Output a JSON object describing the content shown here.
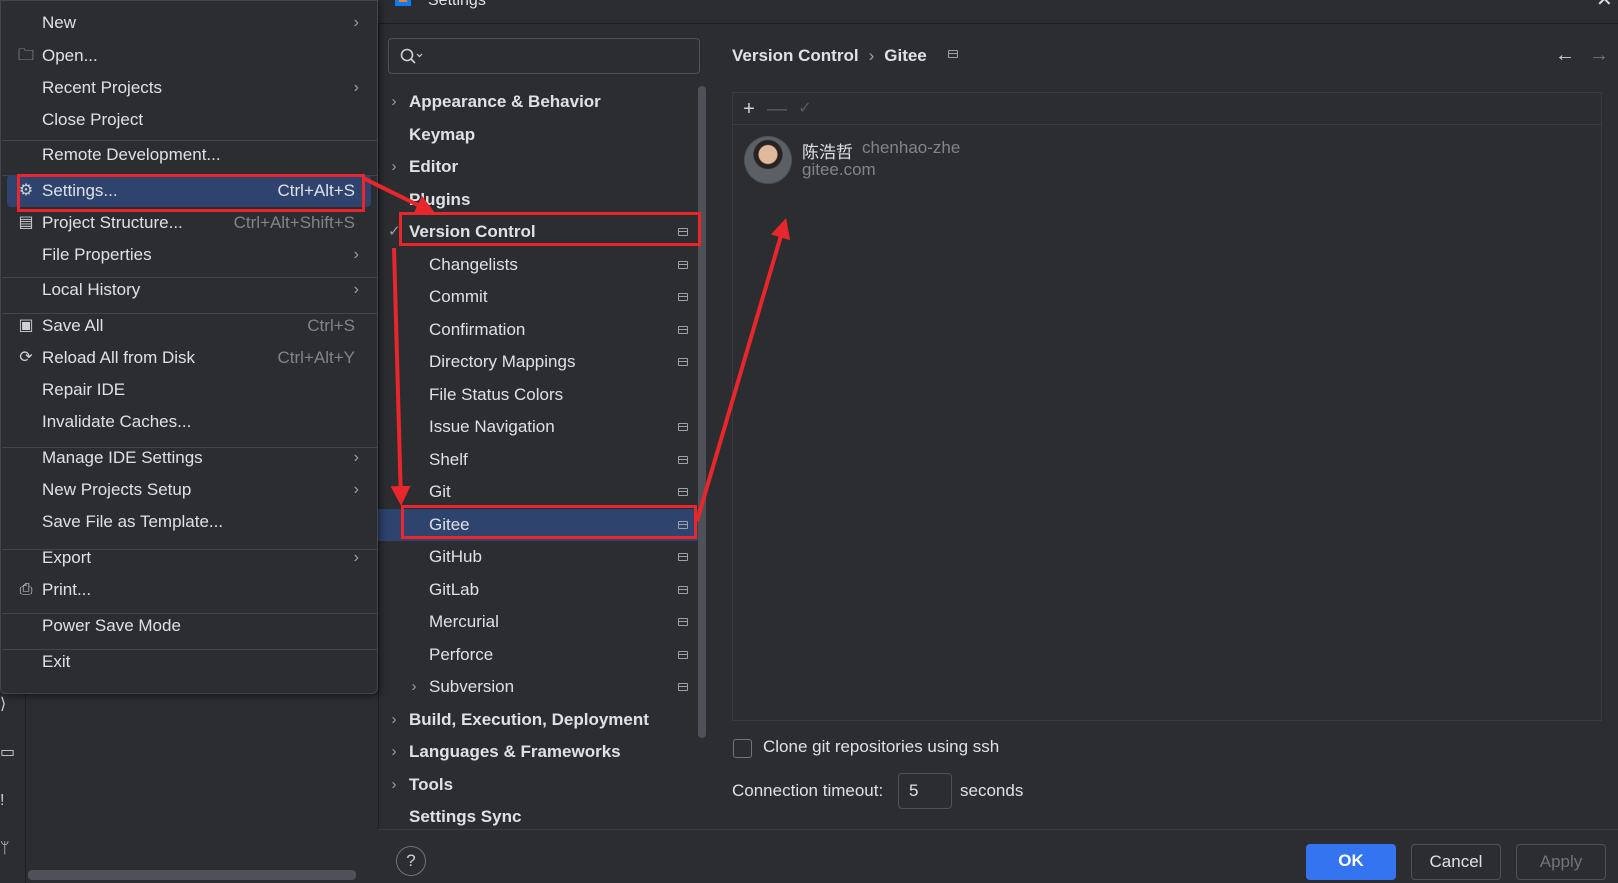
{
  "dialog": {
    "title": "Settings",
    "search_placeholder": "",
    "tree": [
      {
        "label": "Appearance & Behavior",
        "bold": true,
        "chevron": "›",
        "indent": 0,
        "page_icon": false
      },
      {
        "label": "Keymap",
        "bold": true,
        "chevron": "",
        "indent": 0,
        "page_icon": false
      },
      {
        "label": "Editor",
        "bold": true,
        "chevron": "›",
        "indent": 0,
        "page_icon": false
      },
      {
        "label": "Plugins",
        "bold": true,
        "chevron": "",
        "indent": 0,
        "page_icon": false
      },
      {
        "label": "Version Control",
        "bold": true,
        "chevron": "✓",
        "indent": 0,
        "page_icon": true
      },
      {
        "label": "Changelists",
        "bold": false,
        "chevron": "",
        "indent": 1,
        "page_icon": true
      },
      {
        "label": "Commit",
        "bold": false,
        "chevron": "",
        "indent": 1,
        "page_icon": true
      },
      {
        "label": "Confirmation",
        "bold": false,
        "chevron": "",
        "indent": 1,
        "page_icon": true
      },
      {
        "label": "Directory Mappings",
        "bold": false,
        "chevron": "",
        "indent": 1,
        "page_icon": true
      },
      {
        "label": "File Status Colors",
        "bold": false,
        "chevron": "",
        "indent": 1,
        "page_icon": false
      },
      {
        "label": "Issue Navigation",
        "bold": false,
        "chevron": "",
        "indent": 1,
        "page_icon": true
      },
      {
        "label": "Shelf",
        "bold": false,
        "chevron": "",
        "indent": 1,
        "page_icon": true
      },
      {
        "label": "Git",
        "bold": false,
        "chevron": "",
        "indent": 1,
        "page_icon": true
      },
      {
        "label": "Gitee",
        "bold": false,
        "chevron": "",
        "indent": 1,
        "page_icon": true,
        "selected": true
      },
      {
        "label": "GitHub",
        "bold": false,
        "chevron": "",
        "indent": 1,
        "page_icon": true
      },
      {
        "label": "GitLab",
        "bold": false,
        "chevron": "",
        "indent": 1,
        "page_icon": true
      },
      {
        "label": "Mercurial",
        "bold": false,
        "chevron": "",
        "indent": 1,
        "page_icon": true
      },
      {
        "label": "Perforce",
        "bold": false,
        "chevron": "",
        "indent": 1,
        "page_icon": true
      },
      {
        "label": "Subversion",
        "bold": false,
        "chevron": "›",
        "indent": 1,
        "page_icon": true
      },
      {
        "label": "Build, Execution, Deployment",
        "bold": true,
        "chevron": "›",
        "indent": 0,
        "page_icon": false
      },
      {
        "label": "Languages & Frameworks",
        "bold": true,
        "chevron": "›",
        "indent": 0,
        "page_icon": false
      },
      {
        "label": "Tools",
        "bold": true,
        "chevron": "›",
        "indent": 0,
        "page_icon": false
      },
      {
        "label": "Settings Sync",
        "bold": true,
        "chevron": "",
        "indent": 0,
        "page_icon": false
      }
    ],
    "breadcrumb": {
      "parent": "Version Control",
      "separator": "›",
      "current": "Gitee"
    },
    "accounts_toolbar": {
      "add": "+",
      "remove": "—",
      "default": "✓"
    },
    "account": {
      "name": "陈浩哲",
      "login": "chenhao-zhe",
      "server": "gitee.com"
    },
    "ssh_label": "Clone git repositories using ssh",
    "ssh_checked": false,
    "timeout_label": "Connection timeout:",
    "timeout_value": "5",
    "timeout_suffix": "seconds",
    "help": "?",
    "buttons": {
      "ok": "OK",
      "cancel": "Cancel",
      "apply": "Apply"
    },
    "accent_color": "#3574f0",
    "selection_color": "#2e436e"
  },
  "file_menu": {
    "items": [
      {
        "label": "New",
        "shortcut": "",
        "arrow": true,
        "icon": ""
      },
      {
        "label": "Open...",
        "shortcut": "",
        "arrow": false,
        "icon": "folder-icon"
      },
      {
        "label": "Recent Projects",
        "shortcut": "",
        "arrow": true,
        "icon": ""
      },
      {
        "label": "Close Project",
        "shortcut": "",
        "arrow": false,
        "icon": ""
      },
      {
        "label": "Remote Development...",
        "shortcut": "",
        "arrow": false,
        "icon": ""
      },
      {
        "label": "Settings...",
        "shortcut": "Ctrl+Alt+S",
        "arrow": false,
        "icon": "gear-icon",
        "selected": true
      },
      {
        "label": "Project Structure...",
        "shortcut": "Ctrl+Alt+Shift+S",
        "arrow": false,
        "icon": "project-structure-icon"
      },
      {
        "label": "File Properties",
        "shortcut": "",
        "arrow": true,
        "icon": ""
      },
      {
        "label": "Local History",
        "shortcut": "",
        "arrow": true,
        "icon": ""
      },
      {
        "label": "Save All",
        "shortcut": "Ctrl+S",
        "arrow": false,
        "icon": "save-icon"
      },
      {
        "label": "Reload All from Disk",
        "shortcut": "Ctrl+Alt+Y",
        "arrow": false,
        "icon": "reload-icon"
      },
      {
        "label": "Repair IDE",
        "shortcut": "",
        "arrow": false,
        "icon": ""
      },
      {
        "label": "Invalidate Caches...",
        "shortcut": "",
        "arrow": false,
        "icon": ""
      },
      {
        "label": "Manage IDE Settings",
        "shortcut": "",
        "arrow": true,
        "icon": ""
      },
      {
        "label": "New Projects Setup",
        "shortcut": "",
        "arrow": true,
        "icon": ""
      },
      {
        "label": "Save File as Template...",
        "shortcut": "",
        "arrow": false,
        "icon": ""
      },
      {
        "label": "Export",
        "shortcut": "",
        "arrow": true,
        "icon": ""
      },
      {
        "label": "Print...",
        "shortcut": "",
        "arrow": false,
        "icon": "print-icon"
      },
      {
        "label": "Power Save Mode",
        "shortcut": "",
        "arrow": false,
        "icon": ""
      },
      {
        "label": "Exit",
        "shortcut": "",
        "arrow": false,
        "icon": ""
      }
    ],
    "arrow_glyph": "›"
  },
  "annotation_color": "#e8262c"
}
